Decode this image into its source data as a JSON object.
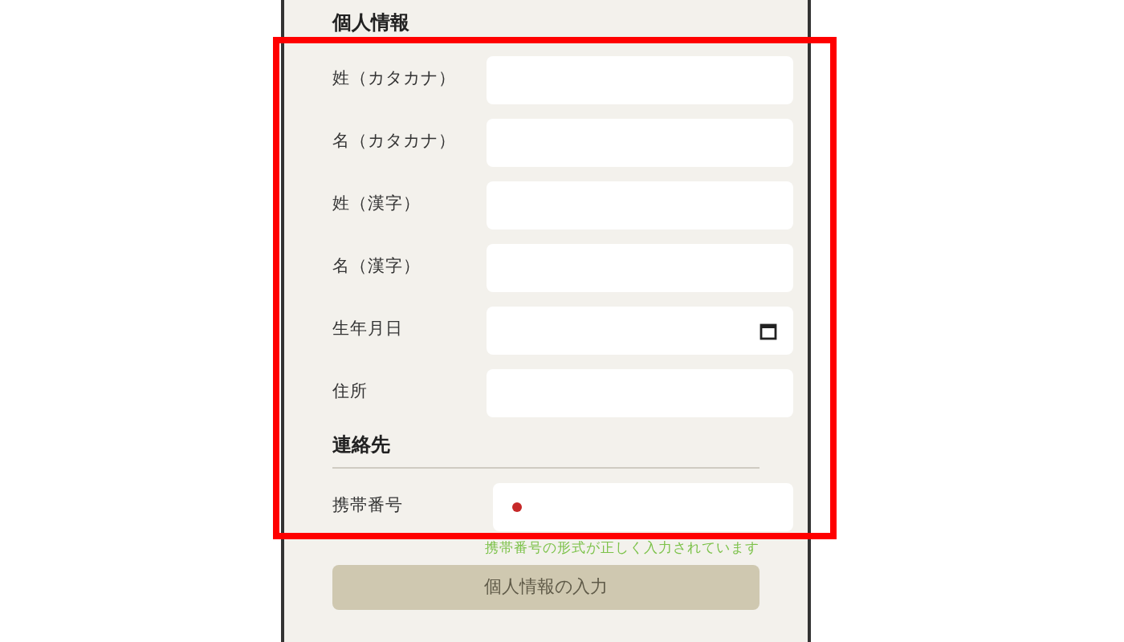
{
  "personal_section": {
    "title": "個人情報",
    "fields": [
      {
        "label": "姓（カタカナ）",
        "kind": "text"
      },
      {
        "label": "名（カタカナ）",
        "kind": "text"
      },
      {
        "label": "姓（漢字）",
        "kind": "text"
      },
      {
        "label": "名（漢字）",
        "kind": "text"
      },
      {
        "label": "生年月日",
        "kind": "date"
      },
      {
        "label": "住所",
        "kind": "text"
      }
    ]
  },
  "contact_section": {
    "title": "連絡先",
    "fields": [
      {
        "label": "携帯番号",
        "kind": "phone"
      }
    ],
    "validation_message": "携帯番号の形式が正しく入力されています"
  },
  "submit_button": {
    "label": "個人情報の入力",
    "disabled": true
  }
}
